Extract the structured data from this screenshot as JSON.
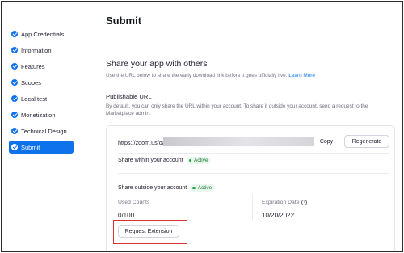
{
  "sidebar": {
    "items": [
      {
        "label": "App Credentials",
        "active": false
      },
      {
        "label": "Information",
        "active": false
      },
      {
        "label": "Features",
        "active": false
      },
      {
        "label": "Scopes",
        "active": false
      },
      {
        "label": "Local test",
        "active": false
      },
      {
        "label": "Monetization",
        "active": false
      },
      {
        "label": "Technical Design",
        "active": false
      },
      {
        "label": "Submit",
        "active": true
      }
    ]
  },
  "main": {
    "title": "Submit",
    "share_section": {
      "title": "Share your app with others",
      "description": "Use the URL below to share the early download link before it goes officially live.",
      "learn_more": "Learn More"
    },
    "publishable": {
      "title": "Publishable URL",
      "description": "By default, you can only share the URL within your account. To share it outside your account, send a request to the Marketplace admin."
    },
    "card": {
      "url": "https://zoom.us/oa",
      "copy_label": "Copy",
      "regenerate_label": "Regenerate",
      "share_within_label": "Share within your account",
      "share_within_status": "Active",
      "share_outside_label": "Share outside your account",
      "share_outside_status": "Active",
      "used_counts_label": "Used Counts",
      "used_counts_value": "0/100",
      "expiration_label": "Expiration Date",
      "expiration_value": "10/20/2022",
      "request_extension_label": "Request Extension"
    }
  },
  "colors": {
    "accent": "#0e72ed",
    "active_green": "#24a148",
    "highlight_red": "#d6302f"
  }
}
